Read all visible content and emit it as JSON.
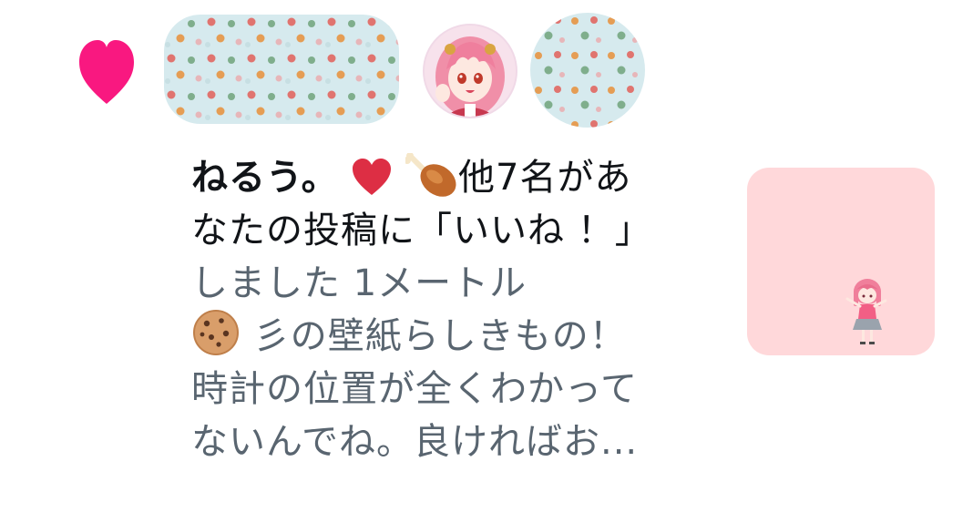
{
  "notification": {
    "type_icon": "heart-icon",
    "accent_color": "#f91880",
    "liker": "ねるう。",
    "liker_emojis": [
      "red-heart-emoji",
      "poultry-leg-emoji"
    ],
    "action_text_a": "他7名があ",
    "action_text_b": "なたの投稿に「いいね ！」",
    "action_text_c": "しました",
    "post_author": "1メートル",
    "post_emoji": "cookie-emoji",
    "post_line_1": "彡の壁紙らしきもの！",
    "post_line_2": "時計の位置が全くわかって",
    "post_line_3": "ないんでね。良ければお..."
  },
  "colors": {
    "text_primary": "#111418",
    "text_secondary": "#596570",
    "thumbnail_bg": "#ffd8da",
    "redaction_bg": "#d6eaee"
  }
}
